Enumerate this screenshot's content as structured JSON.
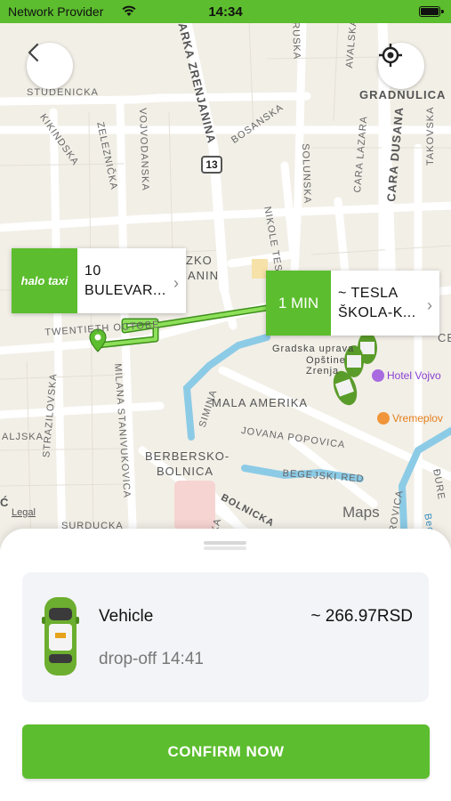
{
  "status_bar": {
    "carrier": "Network Provider",
    "time": "14:34"
  },
  "map": {
    "street_labels": {
      "studenicka": "STUDENICKA",
      "kikindska": "KIKINDSKA",
      "zelezni": "ZELEZNIČKA",
      "vojvodanska": "VOJVODANSKA",
      "zrenjanina": "ARKA ZRENJANINA",
      "bosanska": "BOSANSKA",
      "ruska": "RUSKA",
      "avalska": "AVALSKA",
      "gradnulica": "GRADNULICA",
      "solunska": "SOLUNSKA",
      "cara_lazara": "CARA LAZARA",
      "cara_dusana": "CARA DUSANA",
      "takovska": "TAKOVSKA",
      "nikole_tesle": "NIKOLE TESLE",
      "twentieth": "TWENTIETH OCTOBE",
      "zko": "ZKO",
      "anin": "ANIN",
      "gradska_uprava": "Gradska uprava",
      "opstine": "Opštine",
      "zrenjan": "Zrenja",
      "strazilovska": "STRAZILOVSKA",
      "milana": "MILANA STANIVUKOVICA",
      "simina": "SIMINA",
      "mala_amerika": "MALA AMERIKA",
      "berbersko": "BERBERSKO-",
      "bolnica": "BOLNICA",
      "jovana_popovica": "JOVANA POPOVICA",
      "begejski_red": "BEGEJSKI RED",
      "bolnicka": "BOLNICKA",
      "aljska": "ALJSKA",
      "surducka": "SURDUCKA",
      "ce": "CE",
      "dure": "ĐURE",
      "begejska": "Bege",
      "roviceva": "ROVICA",
      "iska": "ISKA",
      "c_edge": "Ć"
    },
    "route_shield": "13",
    "pickup_callout": {
      "logo": "halo taxi",
      "line1": "10",
      "line2": "BULEVAR..."
    },
    "dropoff_callout": {
      "eta": "1 MIN",
      "line1": "~ TESLA",
      "line2": "ŠKOLA-K..."
    },
    "poi_hotel": "Hotel Vojvo",
    "poi_vreme": "Vremeplov",
    "legal": "Legal",
    "provider": "Maps"
  },
  "sheet": {
    "vehicle_name": "Vehicle",
    "price": "~ 266.97RSD",
    "dropoff": "drop-off 14:41",
    "confirm_label": "CONFIRM NOW"
  },
  "colors": {
    "accent": "#5cbd2e",
    "water": "#8ccbe6",
    "route": "#5cbd2e"
  }
}
